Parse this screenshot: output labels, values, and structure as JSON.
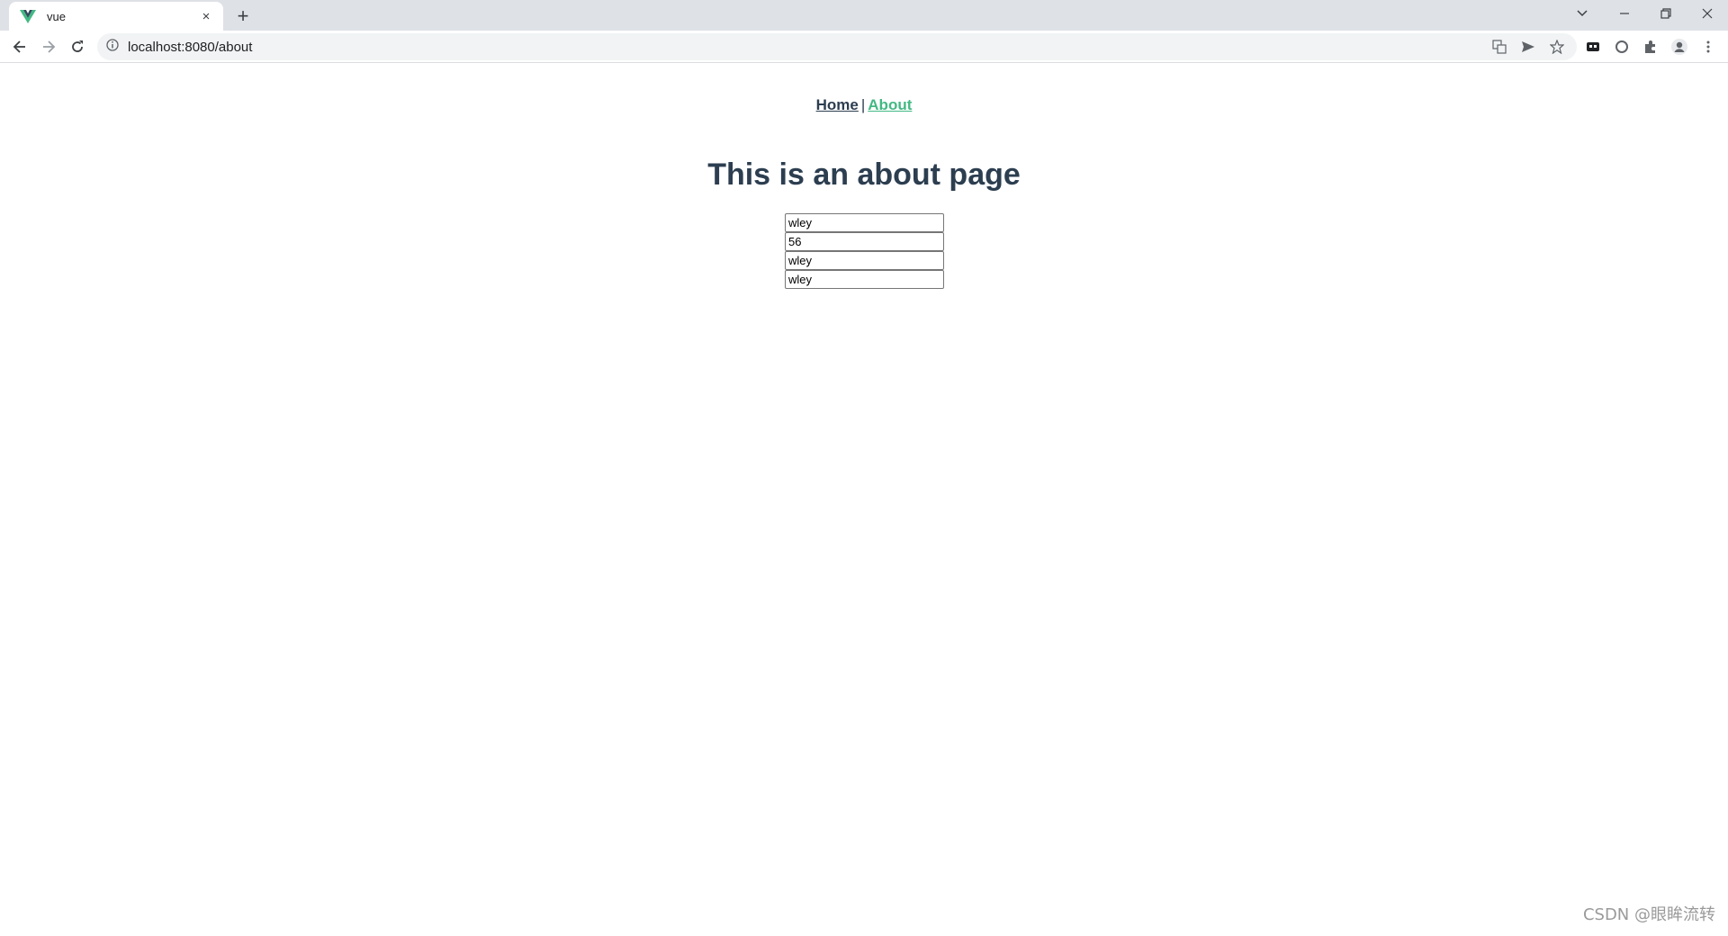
{
  "browser": {
    "tab": {
      "title": "vue",
      "close_label": "×"
    },
    "new_tab_label": "+",
    "address": "localhost:8080/about",
    "window_controls": {
      "minimize": "–",
      "restore": "❐",
      "close": "✕"
    }
  },
  "colors": {
    "vue_green": "#42b983",
    "text_dark": "#2c3e50"
  },
  "app": {
    "nav": {
      "home": "Home",
      "separator": "|",
      "about": "About"
    },
    "title": "This is an about page",
    "fields": [
      "wley",
      "56",
      "wley",
      "wley"
    ]
  },
  "watermark": "CSDN @眼眸流转"
}
